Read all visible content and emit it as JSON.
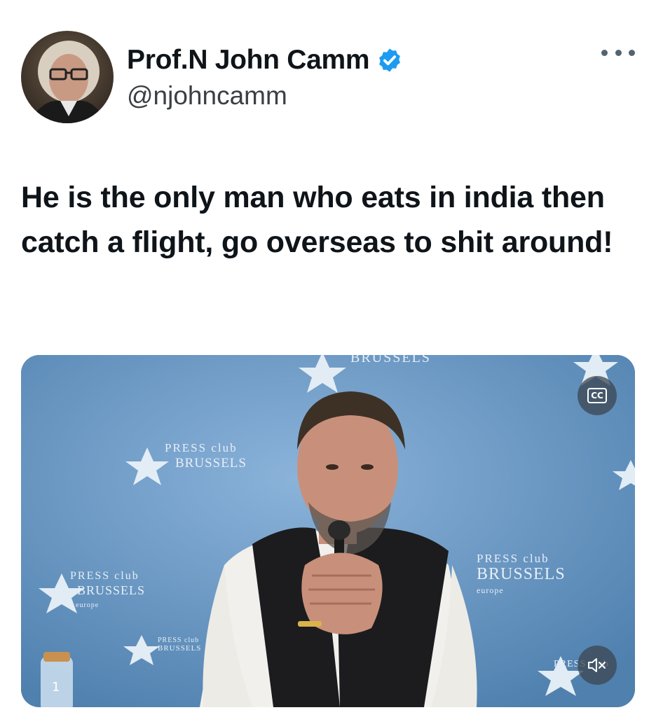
{
  "author": {
    "display_name": "Prof.N John Camm",
    "handle": "@njohncamm",
    "verified": true,
    "verified_color": "#1d9bf0"
  },
  "tweet": {
    "text": "He is the only man who eats in india then catch a flight, go overseas to shit around!"
  },
  "media": {
    "type": "video",
    "backdrop_text": [
      "PRESS club",
      "BRUSSELS",
      "europe"
    ],
    "controls": {
      "captions_label": "CC",
      "mute_icon": "speaker-muted-icon"
    }
  },
  "icons": {
    "more": "more-options-icon",
    "verified": "verified-badge-icon"
  }
}
